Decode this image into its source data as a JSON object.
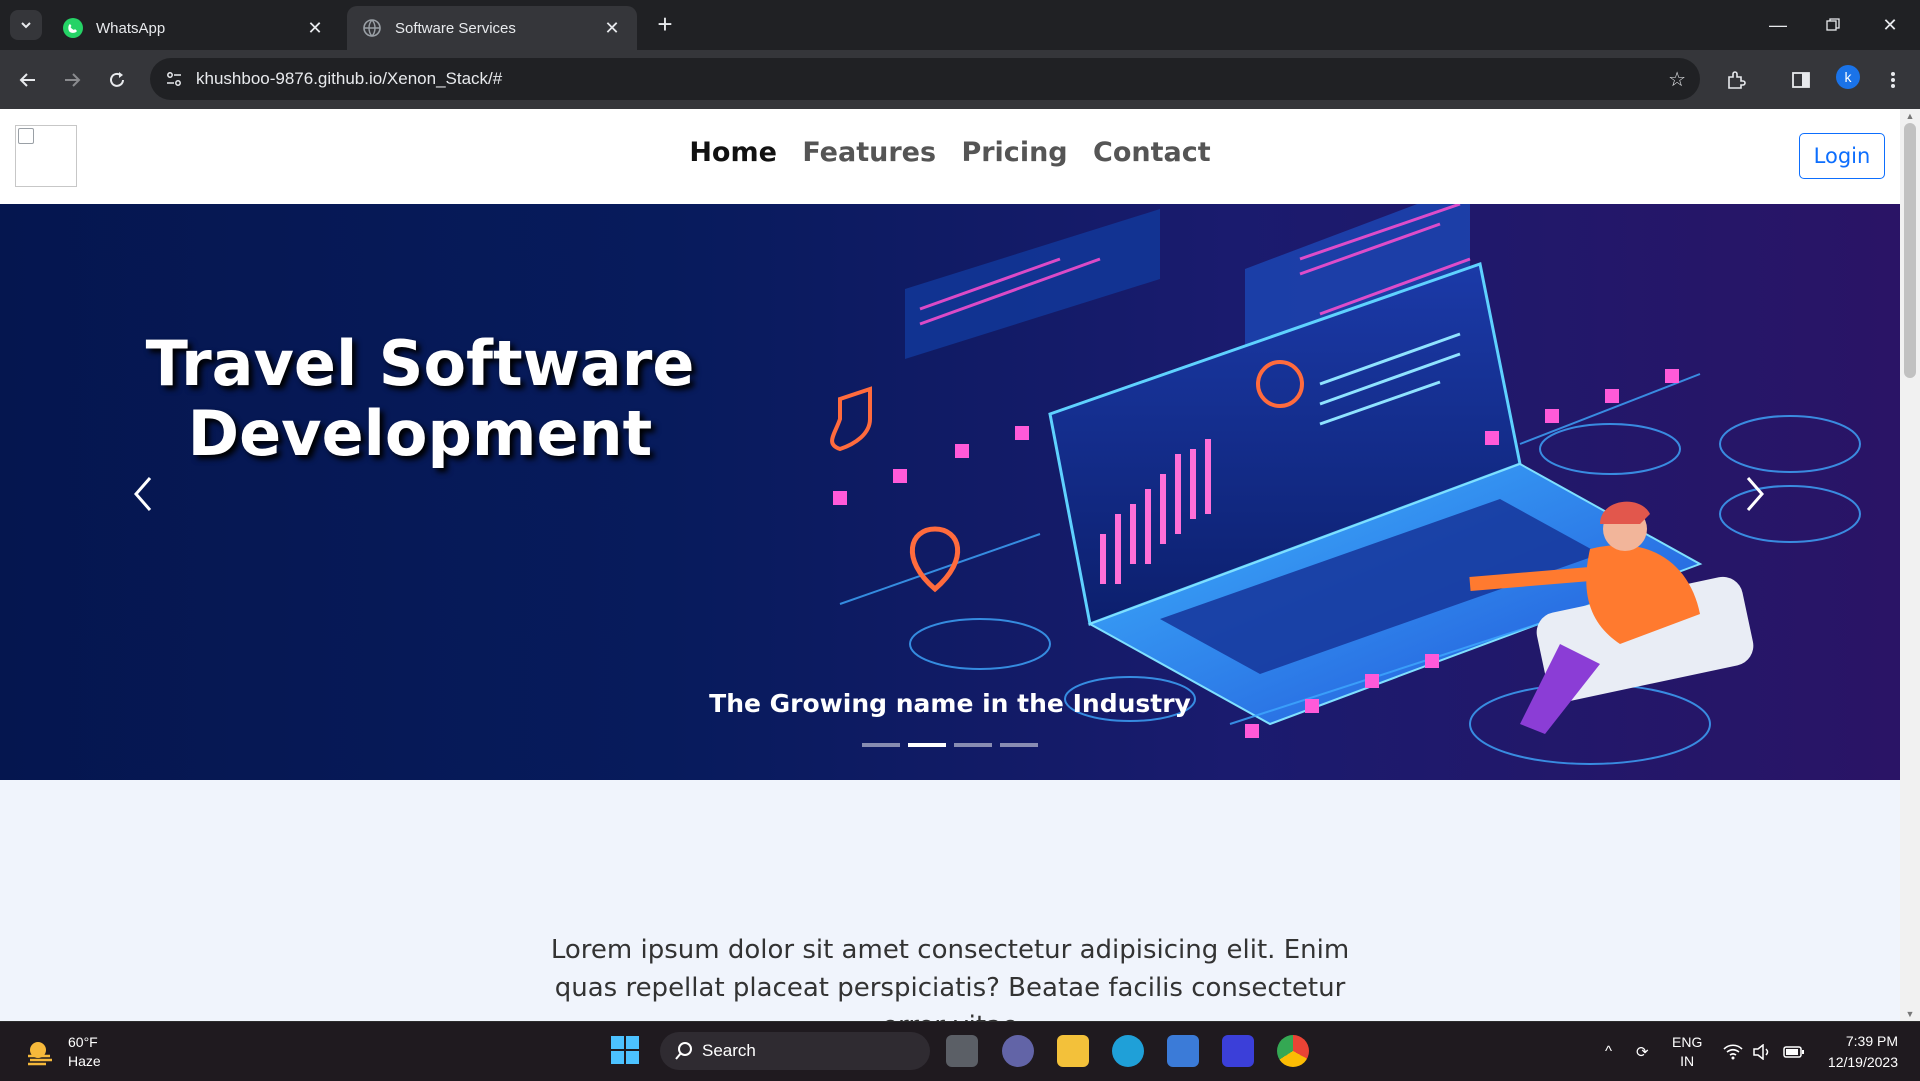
{
  "browser": {
    "tabs": [
      {
        "title": "WhatsApp",
        "active": false,
        "icon": "whatsapp-icon"
      },
      {
        "title": "Software Services",
        "active": true,
        "icon": "globe-icon"
      }
    ],
    "url": "khushboo-9876.github.io/Xenon_Stack/#",
    "profile_initial": "k"
  },
  "site": {
    "nav": {
      "links": [
        "Home",
        "Features",
        "Pricing",
        "Contact"
      ],
      "active": "Home",
      "login_label": "Login"
    },
    "carousel": {
      "heading_line1": "Travel Software",
      "heading_line2": "Development",
      "caption": "The Growing name in the Industry",
      "indicator_count": 4,
      "active_indicator": 2
    },
    "body_text": "Lorem ipsum dolor sit amet consectetur adipisicing elit. Enim quas repellat placeat perspiciatis? Beatae facilis consectetur error vitae"
  },
  "taskbar": {
    "weather_temp": "60°F",
    "weather_desc": "Haze",
    "search_label": "Search",
    "lang_line1": "ENG",
    "lang_line2": "IN",
    "time": "7:39 PM",
    "date": "12/19/2023"
  },
  "colors": {
    "accent": "#0d6efd",
    "browser_dark": "#202124",
    "browser_toolbar": "#35363a",
    "hero_bg": "#071b5c"
  }
}
